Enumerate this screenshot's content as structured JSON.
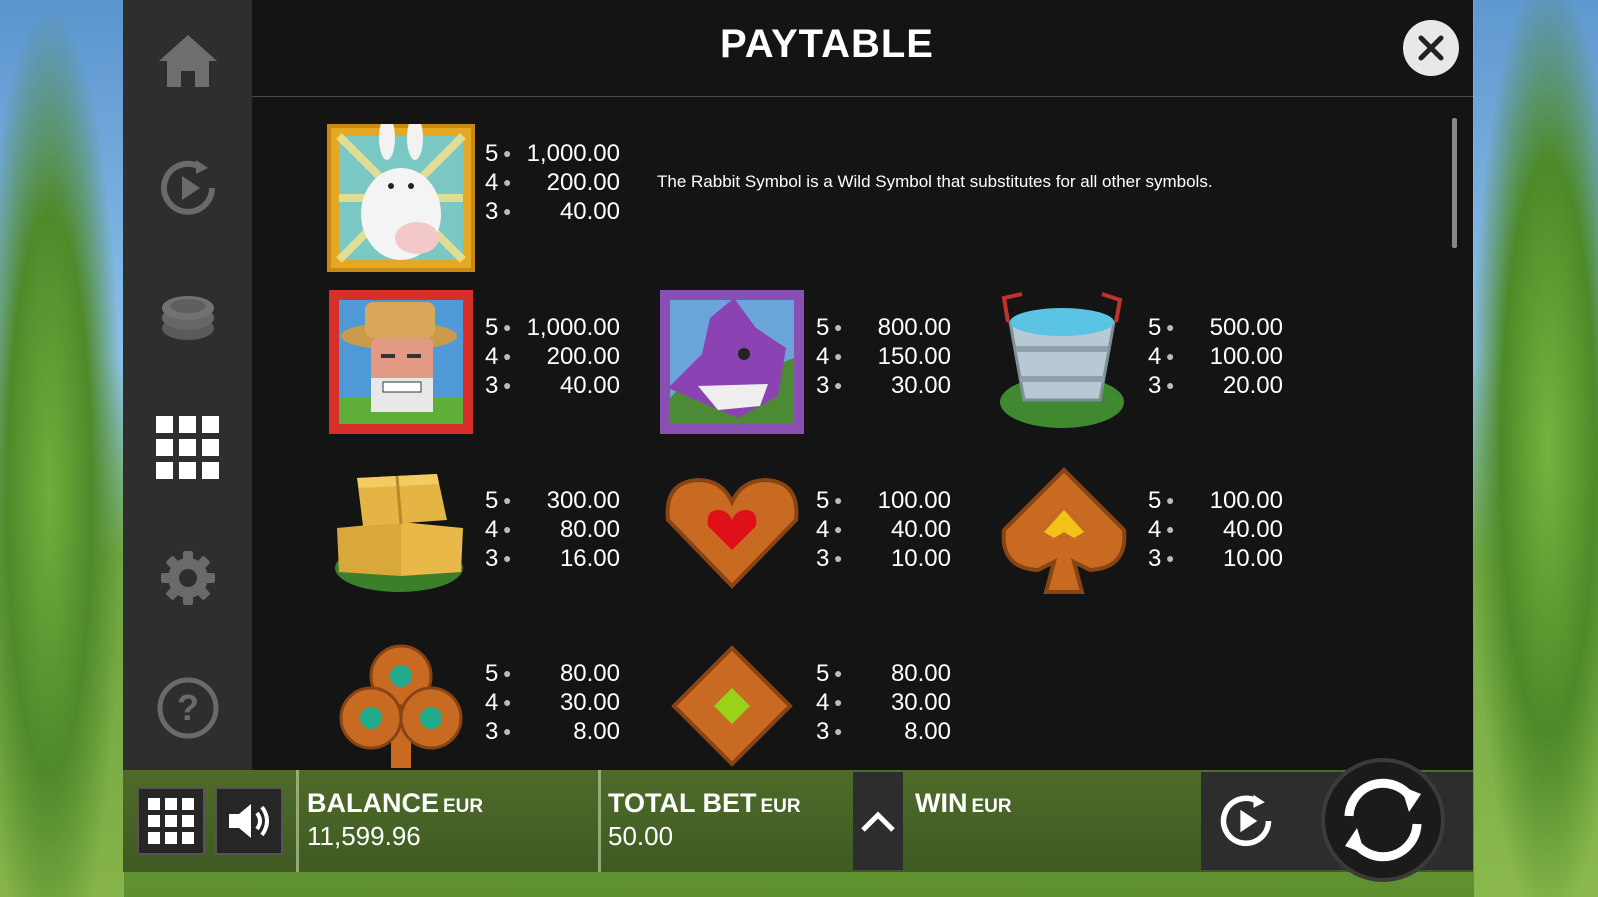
{
  "title": "PAYTABLE",
  "sidebar": {
    "items": [
      {
        "icon": "home-icon"
      },
      {
        "icon": "autoplay-icon"
      },
      {
        "icon": "coins-icon"
      },
      {
        "icon": "paytable-grid-icon"
      },
      {
        "icon": "settings-gear-icon"
      },
      {
        "icon": "help-icon"
      }
    ]
  },
  "wild_description": "The Rabbit Symbol is a Wild Symbol that substitutes for all other symbols.",
  "symbols": [
    {
      "name": "rabbit",
      "pays": [
        {
          "n": "5",
          "v": "1,000.00"
        },
        {
          "n": "4",
          "v": "200.00"
        },
        {
          "n": "3",
          "v": "40.00"
        }
      ]
    },
    {
      "name": "farmer",
      "pays": [
        {
          "n": "5",
          "v": "1,000.00"
        },
        {
          "n": "4",
          "v": "200.00"
        },
        {
          "n": "3",
          "v": "40.00"
        }
      ]
    },
    {
      "name": "fox",
      "pays": [
        {
          "n": "5",
          "v": "800.00"
        },
        {
          "n": "4",
          "v": "150.00"
        },
        {
          "n": "3",
          "v": "30.00"
        }
      ]
    },
    {
      "name": "bucket",
      "pays": [
        {
          "n": "5",
          "v": "500.00"
        },
        {
          "n": "4",
          "v": "100.00"
        },
        {
          "n": "3",
          "v": "20.00"
        }
      ]
    },
    {
      "name": "hay",
      "pays": [
        {
          "n": "5",
          "v": "300.00"
        },
        {
          "n": "4",
          "v": "80.00"
        },
        {
          "n": "3",
          "v": "16.00"
        }
      ]
    },
    {
      "name": "heart",
      "pays": [
        {
          "n": "5",
          "v": "100.00"
        },
        {
          "n": "4",
          "v": "40.00"
        },
        {
          "n": "3",
          "v": "10.00"
        }
      ]
    },
    {
      "name": "spade",
      "pays": [
        {
          "n": "5",
          "v": "100.00"
        },
        {
          "n": "4",
          "v": "40.00"
        },
        {
          "n": "3",
          "v": "10.00"
        }
      ]
    },
    {
      "name": "club",
      "pays": [
        {
          "n": "5",
          "v": "80.00"
        },
        {
          "n": "4",
          "v": "30.00"
        },
        {
          "n": "3",
          "v": "8.00"
        }
      ]
    },
    {
      "name": "diamond",
      "pays": [
        {
          "n": "5",
          "v": "80.00"
        },
        {
          "n": "4",
          "v": "30.00"
        },
        {
          "n": "3",
          "v": "8.00"
        }
      ]
    }
  ],
  "bottom_bar": {
    "balance_label": "BALANCE",
    "balance_currency": "EUR",
    "balance_value": "11,599.96",
    "bet_label": "TOTAL BET",
    "bet_currency": "EUR",
    "bet_value": "50.00",
    "win_label": "WIN",
    "win_currency": "EUR"
  },
  "colors": {
    "panel": "#1a1a1a",
    "sidebar": "#2e2e2e",
    "bar": "#4e6b2a"
  }
}
